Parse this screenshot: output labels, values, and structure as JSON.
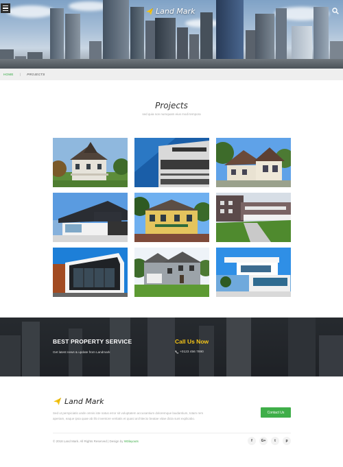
{
  "header": {
    "brand": "Land Mark",
    "menu_icon": "hamburger-icon",
    "search_icon": "search-icon"
  },
  "breadcrumb": {
    "home": "HOME",
    "separator": "|",
    "current": "PROJECTS"
  },
  "projects": {
    "title": "Projects",
    "subtitle": "sed quia non numquam eius modi tempora",
    "items": [
      {
        "scene": "victorian-house"
      },
      {
        "scene": "modern-facade-blue"
      },
      {
        "scene": "suburban-house"
      },
      {
        "scene": "modern-villa"
      },
      {
        "scene": "yellow-mansion"
      },
      {
        "scene": "office-lawn"
      },
      {
        "scene": "glass-cube-house"
      },
      {
        "scene": "gray-house"
      },
      {
        "scene": "white-modern-house"
      }
    ]
  },
  "cta": {
    "heading": "BEST PROPERTY SERVICE",
    "text": "Get latest news & update from Landmark",
    "call_heading": "Call Us Now",
    "phone": "+0123 456 7890"
  },
  "footer": {
    "brand": "Land Mark",
    "text": "Sed ut perspiciatis unde omnis iste natus error sit voluptatem accusantium doloremque laudantium, totam rem aperiam, eaque ipsa quae ab illo inventore veritatis et quasi architecto beatae vitae dicta sunt explicabo.",
    "contact_button": "Contact Us",
    "copyright": "© 2018 Land Mark. All Rights Reserved | Design by",
    "designer": "W3layouts",
    "socials": [
      "f",
      "G+",
      "t",
      "p"
    ]
  },
  "colors": {
    "accent_green": "#3fae49",
    "accent_yellow": "#f5c518",
    "breadcrumb_bg": "#efefef"
  }
}
